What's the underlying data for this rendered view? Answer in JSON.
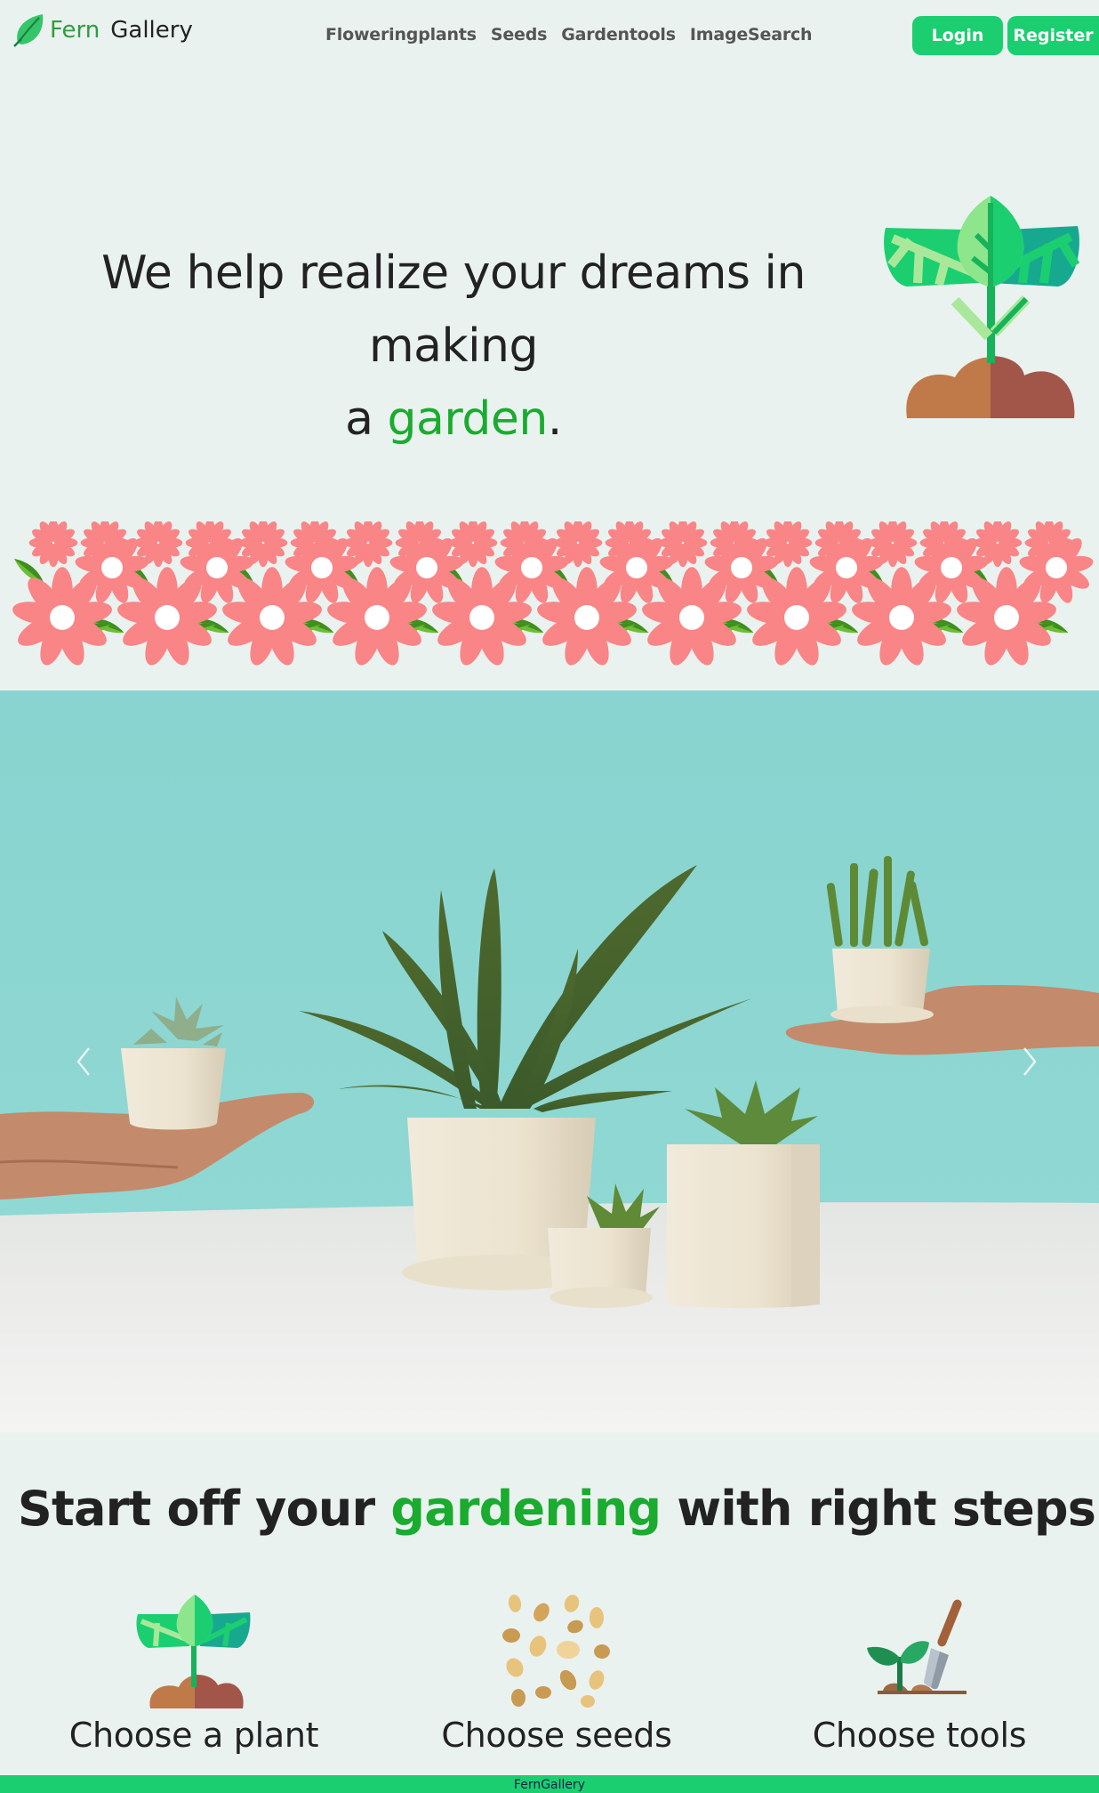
{
  "brand": {
    "name_part1": "Fern",
    "name_part2": "Gallery"
  },
  "nav": {
    "links": [
      "Floweringplants",
      "Seeds",
      "Gardentools",
      "ImageSearch"
    ],
    "login_label": "Login",
    "register_label": "Register"
  },
  "hero": {
    "line1": "We help realize your dreams in making",
    "line2_prefix": "a ",
    "line2_accent": "garden",
    "line2_suffix": "."
  },
  "carousel": {
    "prev_glyph": "‹",
    "next_glyph": "›"
  },
  "steps": {
    "title_prefix": "Start off your ",
    "title_accent": "gardening",
    "title_suffix": " with right steps",
    "items": [
      {
        "label": "Choose a plant",
        "icon": "sprout-icon"
      },
      {
        "label": "Choose seeds",
        "icon": "seeds-icon"
      },
      {
        "label": "Choose tools",
        "icon": "shovel-icon"
      }
    ]
  },
  "footer": {
    "text": "FernGallery"
  },
  "colors": {
    "accent_green": "#1aab2f",
    "button_green": "#1bcf70",
    "background": "#eaf2f0",
    "flower_pink": "#f98586",
    "carousel_bg": "#8fd3d0"
  }
}
